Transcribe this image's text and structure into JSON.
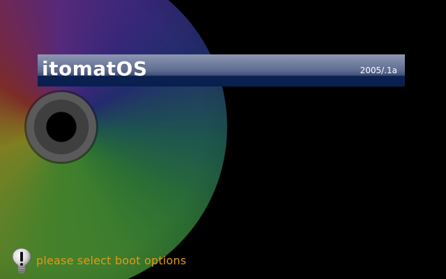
{
  "brand": {
    "title": "itomatOS",
    "version": "2005/.1a"
  },
  "status": {
    "message": "please select boot options",
    "icon": "exclamation-icon",
    "color": "#e29a16"
  },
  "colors": {
    "background": "#000000",
    "title_bar_top": "#8e97b3",
    "title_bar_bottom": "#08204f"
  }
}
